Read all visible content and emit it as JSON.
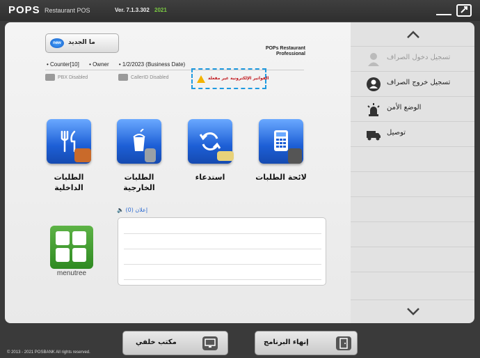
{
  "header": {
    "logo": "POPS",
    "logo_subtitle": "Restaurant POS",
    "version": "Ver. 7.1.3.302",
    "version_year": "2021"
  },
  "main": {
    "whats_new_badge": "new",
    "whats_new_label": "ما الجديد",
    "store_name_line1": "POPs Restaurant",
    "store_name_line2": "Professional",
    "counter": "• Counter[10]",
    "user": "• Owner",
    "business_date": "• 1/2/2023 (Business Date)",
    "pbx_status": "PBX Disabled",
    "callerid_status": "CallerID Disabled",
    "warning_text": "الفواتير الإلكترونية غير مفعلة",
    "tiles": [
      {
        "label_line1": "الطلبات",
        "label_line2": "الداخلية",
        "icon": "dine-in-icon"
      },
      {
        "label_line1": "الطلبات",
        "label_line2": "الخارجية",
        "icon": "takeout-icon"
      },
      {
        "label_line1": "استدعاء",
        "label_line2": "",
        "icon": "recall-icon"
      },
      {
        "label_line1": "لائحة الطلبات",
        "label_line2": "",
        "icon": "order-list-icon"
      }
    ],
    "notice_label": "(إعلان (0",
    "menutree_label": "menutree"
  },
  "sidemenu": {
    "items": [
      {
        "label": "تسجيل دخول الصراف",
        "icon": "cashier-login-icon",
        "enabled": false
      },
      {
        "label": "تسجيل خروج الصراف",
        "icon": "cashier-logout-icon",
        "enabled": true
      },
      {
        "label": "الوضع الأمن",
        "icon": "safe-mode-icon",
        "enabled": true
      },
      {
        "label": "توصيل",
        "icon": "delivery-icon",
        "enabled": true
      }
    ]
  },
  "footer": {
    "back_office_label": "مكتب خلفي",
    "exit_label": "إنهاء البرنامج",
    "copyright": "© 2013 - 2021 POSBANK All rights reserved."
  },
  "colors": {
    "tile_blue": "#1d5fd6",
    "warning_red": "#c0161c",
    "version_green": "#7ac943",
    "menutree_green": "#3c9a2b"
  }
}
